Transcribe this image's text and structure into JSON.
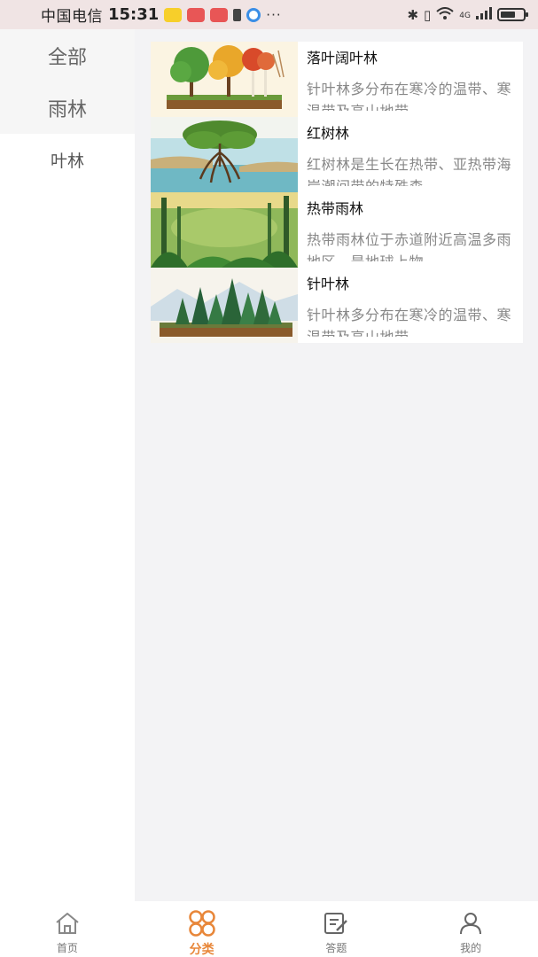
{
  "status_bar": {
    "carrier": "中国电信",
    "time": "15:31",
    "more": "···",
    "network": "4G"
  },
  "sidebar": {
    "items": [
      {
        "label": "全部"
      },
      {
        "label": "雨林"
      },
      {
        "label": "叶林"
      }
    ]
  },
  "list": [
    {
      "title": "落叶阔叶林",
      "desc": "针叶林多分布在寒冷的温带、寒温带及高山地带",
      "image": "deciduous-forest-image"
    },
    {
      "title": "红树林",
      "desc": "红树林是生长在热带、亚热带海岸潮间带的特殊森",
      "image": "mangrove-image"
    },
    {
      "title": "热带雨林",
      "desc": "热带雨林位于赤道附近高温多雨地区，是地球上物",
      "image": "rainforest-image"
    },
    {
      "title": "针叶林",
      "desc": "针叶林多分布在寒冷的温带、寒温带及高山地带",
      "image": "conifer-forest-image"
    }
  ],
  "bottom_nav": [
    {
      "label": "首页",
      "icon": "home-icon"
    },
    {
      "label": "分类",
      "icon": "category-icon"
    },
    {
      "label": "答题",
      "icon": "quiz-icon"
    },
    {
      "label": "我的",
      "icon": "user-icon"
    }
  ],
  "colors": {
    "accent": "#e8873a",
    "status_bar_bg": "#f0e4e4",
    "page_bg": "#f3f3f5"
  }
}
